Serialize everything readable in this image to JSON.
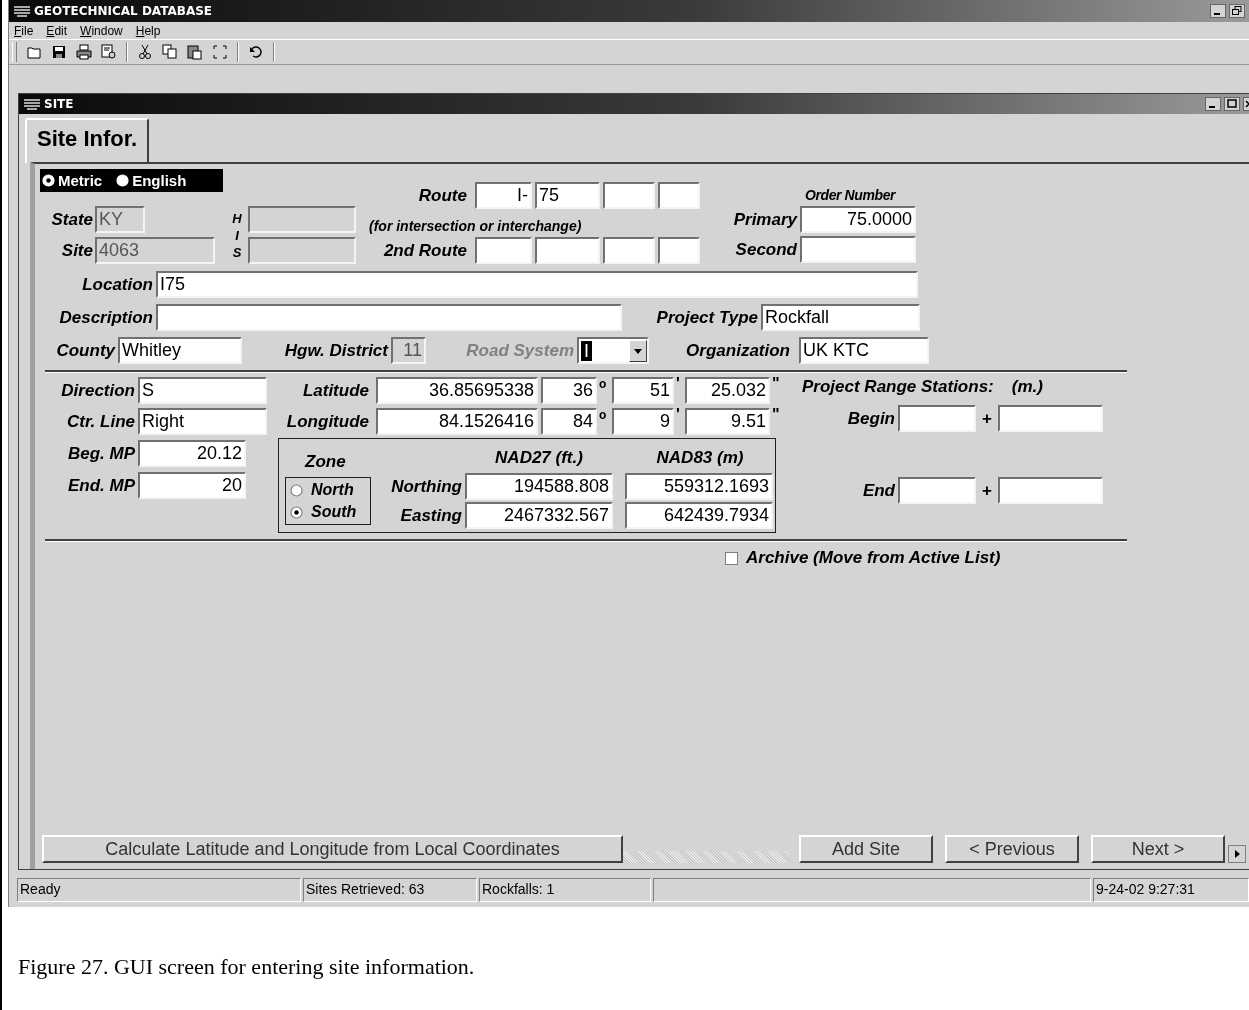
{
  "app": {
    "title": "GEOTECHNICAL DATABASE"
  },
  "menu": [
    "File",
    "Edit",
    "Window",
    "Help"
  ],
  "child": {
    "title": "SITE"
  },
  "tabs": [
    {
      "label": "Site Infor.",
      "selected": true
    }
  ],
  "units": [
    {
      "label": "Metric",
      "selected": true
    },
    {
      "label": "English",
      "selected": false
    }
  ],
  "state": {
    "label": "State",
    "value": "KY",
    "disabled": true
  },
  "site": {
    "label": "Site",
    "value": "4063",
    "disabled": true
  },
  "his": {
    "letters": [
      "H",
      "I",
      "S"
    ],
    "fields": [
      {
        "disabled": true
      },
      {
        "disabled": true
      }
    ]
  },
  "route": {
    "label": "Route",
    "values": [
      "I-",
      "75"
    ]
  },
  "route_note": "(for intersection or interchange)",
  "route2": {
    "label": "2nd Route"
  },
  "order_number": {
    "title": "Order Number",
    "primary": {
      "label": "Primary",
      "value": "75.0000"
    },
    "second": {
      "label": "Second"
    }
  },
  "location": {
    "label": "Location",
    "value": "I75"
  },
  "description": {
    "label": "Description"
  },
  "project_type": {
    "label": "Project Type",
    "value": "Rockfall"
  },
  "county": {
    "label": "County",
    "value": "Whitley"
  },
  "district": {
    "label": "Hgw. District",
    "value": "11",
    "disabled": true
  },
  "road_system": {
    "label": "Road System",
    "value": "I",
    "disabled": true
  },
  "organization": {
    "label": "Organization",
    "value": "UK KTC"
  },
  "direction": {
    "label": "Direction",
    "value": "S"
  },
  "ctr_line": {
    "label": "Ctr. Line",
    "value": "Right"
  },
  "beg_mp": {
    "label": "Beg. MP",
    "value": "20.12"
  },
  "end_mp": {
    "label": "End. MP",
    "value": "20"
  },
  "latitude": {
    "label": "Latitude",
    "decimal": "36.85695338",
    "deg": "36",
    "deg_mark": "o",
    "min": "51",
    "min_mark": "'",
    "sec": "25.032",
    "sec_mark": "\""
  },
  "longitude": {
    "label": "Longitude",
    "decimal": "84.1526416",
    "deg": "84",
    "deg_mark": "o",
    "min": "9",
    "min_mark": "'",
    "sec": "9.51",
    "sec_mark": "\""
  },
  "coordinates": {
    "zone": {
      "label": "Zone",
      "options": [
        {
          "label": "North",
          "selected": false
        },
        {
          "label": "South",
          "selected": true
        }
      ]
    },
    "columns": [
      "NAD27 (ft.)",
      "NAD83 (m)"
    ],
    "rows": [
      {
        "label": "Northing",
        "values": [
          "194588.808",
          "559312.1693"
        ]
      },
      {
        "label": "Easting",
        "values": [
          "2467332.567",
          "642439.7934"
        ]
      }
    ]
  },
  "range_stations": {
    "title": "Project Range Stations:",
    "unit": "(m.)",
    "rows": [
      {
        "label": "Begin",
        "separator": "+"
      },
      {
        "label": "End",
        "separator": "+"
      }
    ]
  },
  "archive": {
    "label": "Archive (Move from Active List)",
    "checked": false
  },
  "buttons": [
    "Calculate Latitude and Longitude from Local Coordinates",
    "Add Site",
    "< Previous",
    "Next >"
  ],
  "status_bar": [
    "Ready",
    "Sites Retrieved: 63",
    "Rockfalls: 1",
    "9-24-02 9:27:31"
  ],
  "caption": "Figure 27.  GUI screen for entering site information."
}
